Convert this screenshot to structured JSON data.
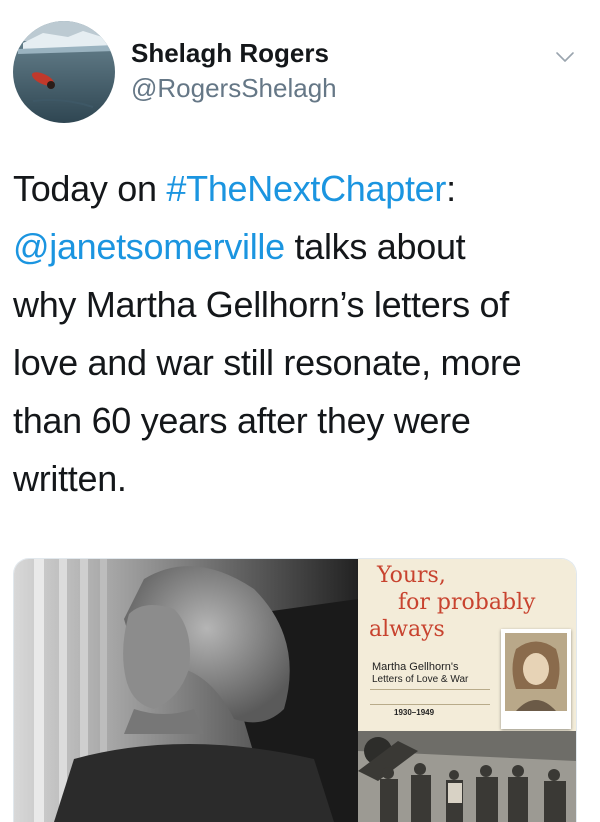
{
  "user": {
    "name": "Shelagh Rogers",
    "handle": "@RogersShelagh"
  },
  "tweet": {
    "t1": "Today on ",
    "hashtag": "#TheNextChapter",
    "t2": ":",
    "mention": "@janetsomerville",
    "t3": " talks about",
    "line3": "why Martha Gellhorn’s letters of",
    "line4": "love and war still resonate, more",
    "line5": "than 60 years after they were",
    "line6": "written."
  },
  "book": {
    "title_line1": "Yours,",
    "title_line2": "for probably",
    "title_line3": "always",
    "subtitle_line1": "Martha Gellhorn's",
    "subtitle_line2": "Letters of Love & War",
    "years": "1930–1949"
  },
  "colors": {
    "link": "#1b95e0",
    "name": "#14171a",
    "handle": "#657786",
    "book_title": "#c8432f",
    "book_bg": "#f3ecd9"
  },
  "icons": {
    "menu": "chevron-down-icon"
  }
}
